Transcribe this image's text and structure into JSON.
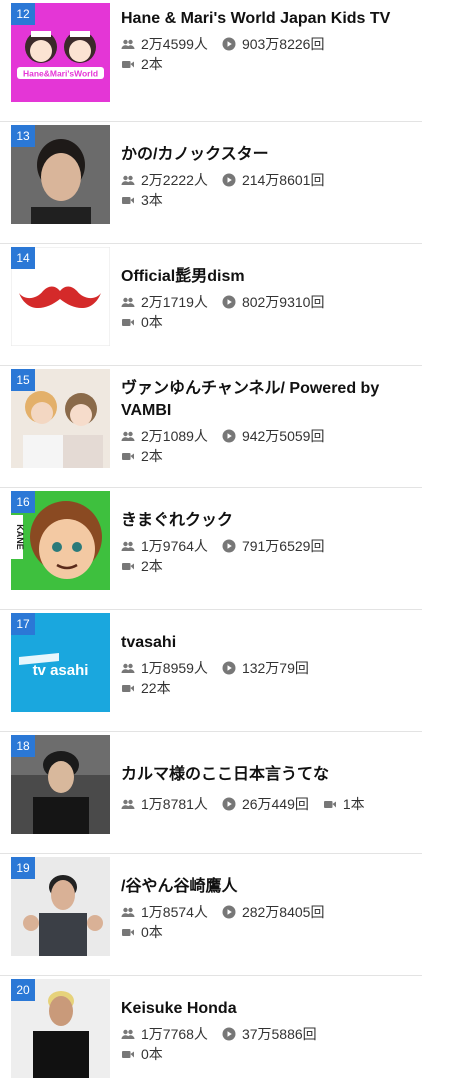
{
  "channels": [
    {
      "rank": "12",
      "name": "Hane & Mari's World Japan Kids TV",
      "subscribers": "2万4599人",
      "views": "903万8226回",
      "videos": "2本",
      "thumb_text": "Hane&Mari'sWorld",
      "thumb_color": "#e436d6"
    },
    {
      "rank": "13",
      "name": "かの/カノックスター",
      "subscribers": "2万2222人",
      "views": "214万8601回",
      "videos": "3本",
      "thumb_color": "#5a5a5a"
    },
    {
      "rank": "14",
      "name": "Official髭男dism",
      "subscribers": "2万1719人",
      "views": "802万9310回",
      "videos": "0本",
      "thumb_color": "#d42a2a"
    },
    {
      "rank": "15",
      "name": "ヴァンゆんチャンネル/ Powered by VAMBI",
      "subscribers": "2万1089人",
      "views": "942万5059回",
      "videos": "2本",
      "thumb_color": "#c9a77f"
    },
    {
      "rank": "16",
      "name": "きまぐれクック",
      "subscribers": "1万9764人",
      "views": "791万6529回",
      "videos": "2本",
      "thumb_text": "KANE",
      "thumb_color": "#3ec03e"
    },
    {
      "rank": "17",
      "name": "tvasahi",
      "subscribers": "1万8959人",
      "views": "132万79回",
      "videos": "22本",
      "thumb_text": "tv asahi",
      "thumb_color": "#1aa7de"
    },
    {
      "rank": "18",
      "name": "カルマ様のここ日本言うてな",
      "subscribers": "1万8781人",
      "views": "26万449回",
      "videos": "1本",
      "thumb_color": "#3a3a3a"
    },
    {
      "rank": "19",
      "name": "/谷やん谷崎鷹人",
      "subscribers": "1万8574人",
      "views": "282万8405回",
      "videos": "0本",
      "thumb_color": "#eaeaea"
    },
    {
      "rank": "20",
      "name": "Keisuke Honda",
      "subscribers": "1万7768人",
      "views": "37万5886回",
      "videos": "0本",
      "thumb_color": "#eeeeee"
    }
  ],
  "colors": {
    "rank_badge": "#2b78d6",
    "icon": "#777777",
    "separator": "#e3e3e3"
  }
}
